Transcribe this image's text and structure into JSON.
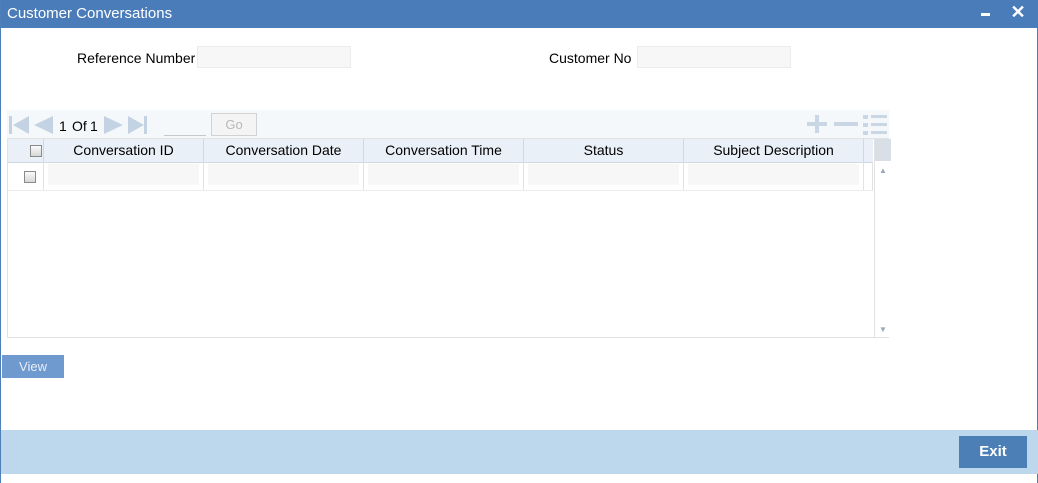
{
  "window": {
    "title": "Customer Conversations"
  },
  "form": {
    "reference_number_label": "Reference Number",
    "reference_number_value": "",
    "customer_no_label": "Customer No",
    "customer_no_value": ""
  },
  "pagination": {
    "current": "1",
    "of_label": "Of",
    "total": "1",
    "page_input": "",
    "go_label": "Go"
  },
  "grid": {
    "columns": [
      "Conversation ID",
      "Conversation Date",
      "Conversation Time",
      "Status",
      "Subject Description"
    ],
    "rows": [
      {
        "checked": false,
        "cells": [
          "",
          "",
          "",
          "",
          ""
        ]
      }
    ]
  },
  "buttons": {
    "view_label": "View",
    "exit_label": "Exit"
  },
  "icons": [
    "first-page-icon",
    "previous-page-icon",
    "next-page-icon",
    "last-page-icon",
    "add-row-icon",
    "delete-row-icon",
    "single-view-icon"
  ],
  "colors": {
    "titlebar": "#4a7cba",
    "footer": "#bdd7ec",
    "exit_button": "#4b7fb5",
    "view_button": "#6f9ad0"
  }
}
